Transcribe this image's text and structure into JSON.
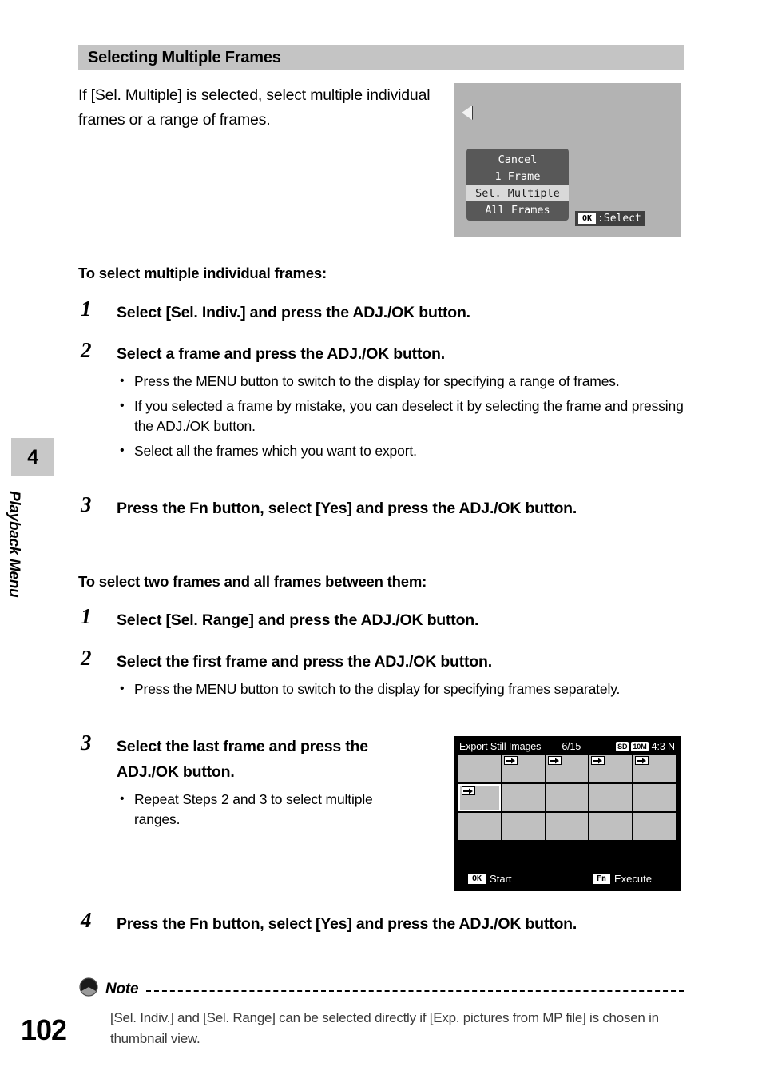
{
  "page": {
    "number": "102",
    "chapter_number": "4",
    "chapter_name": "Playback Menu"
  },
  "section": {
    "header": "Selecting Multiple Frames",
    "intro": "If [Sel. Multiple] is selected, select multiple individual frames or a range of frames."
  },
  "lcd_menu_screen": {
    "arrow_icon": "left-triangle-icon",
    "items": [
      {
        "label": "Cancel",
        "selected": false
      },
      {
        "label": "1 Frame",
        "selected": false
      },
      {
        "label": "Sel. Multiple",
        "selected": true
      },
      {
        "label": "All Frames",
        "selected": false
      }
    ],
    "hint_key": "OK",
    "hint_text": ":Select"
  },
  "part_one": {
    "heading": "To select multiple individual frames:",
    "steps": [
      {
        "num": "1",
        "text": "Select [Sel. Indiv.] and press the ADJ./OK button.",
        "bullets": []
      },
      {
        "num": "2",
        "text": "Select a frame and press the ADJ./OK button.",
        "bullets": [
          "Press the MENU button to switch to the display for specifying a range of frames.",
          "If you selected a frame by mistake, you can deselect it by selecting the frame and pressing the ADJ./OK button.",
          "Select all the frames which you want to export."
        ]
      },
      {
        "num": "3",
        "text": "Press the Fn button, select [Yes] and press the ADJ./OK button.",
        "bullets": []
      }
    ]
  },
  "part_two": {
    "heading": "To select two frames and all frames between them:",
    "steps": [
      {
        "num": "1",
        "text": "Select [Sel. Range] and press the ADJ./OK button.",
        "bullets": []
      },
      {
        "num": "2",
        "text": "Select the first frame and press the ADJ./OK button.",
        "bullets": [
          "Press the MENU button to switch to the display for specifying frames separately."
        ]
      },
      {
        "num": "3",
        "text": "Select the last frame and press the ADJ./OK button.",
        "bullets": [
          "Repeat Steps 2 and 3 to select multiple ranges."
        ]
      },
      {
        "num": "4",
        "text": "Press the Fn button, select [Yes] and press the ADJ./OK button.",
        "bullets": []
      }
    ]
  },
  "lcd_thumbnail_screen": {
    "title": "Export Still Images",
    "count": "6/15",
    "badge_card": "SD",
    "badge_size": "10M",
    "ratio": "4:3 N",
    "grid": {
      "columns": 5,
      "rows": 3,
      "cells": [
        {
          "export": false,
          "selected": false
        },
        {
          "export": true,
          "selected": false
        },
        {
          "export": true,
          "selected": false
        },
        {
          "export": true,
          "selected": false
        },
        {
          "export": true,
          "selected": false
        },
        {
          "export": true,
          "selected": true
        },
        {
          "export": false,
          "selected": false
        },
        {
          "export": false,
          "selected": false
        },
        {
          "export": false,
          "selected": false
        },
        {
          "export": false,
          "selected": false
        },
        {
          "export": false,
          "selected": false
        },
        {
          "export": false,
          "selected": false
        },
        {
          "export": false,
          "selected": false
        },
        {
          "export": false,
          "selected": false
        },
        {
          "export": false,
          "selected": false
        }
      ]
    },
    "footer": {
      "left_key": "OK",
      "left_label": "Start",
      "right_key": "Fn",
      "right_label": "Execute"
    }
  },
  "note": {
    "label": "Note",
    "body": "[Sel. Indiv.] and [Sel. Range] can be selected directly if [Exp. pictures from MP file] is chosen in thumbnail view."
  },
  "colors": {
    "header_bar": "#c4c4c4",
    "lcd_background": "#b3b3b3",
    "lcd_menu": "#585858",
    "lcd_menu_selected": "#d9d9d9",
    "thumbnail_cell": "#c0c0c0"
  }
}
